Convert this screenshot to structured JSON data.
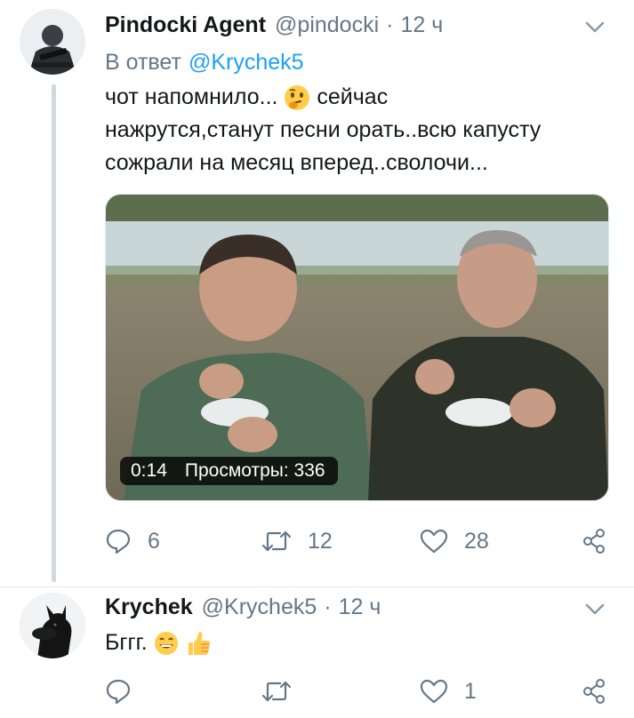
{
  "tweet1": {
    "author_name": "Pindocki Agent",
    "author_handle": "@pindocki",
    "separator": "·",
    "time": "12 ч",
    "reply_prefix": "В ответ",
    "reply_mention": "@Krychek5",
    "text_line1_a": "чот напомнило...",
    "text_line1_b": "сейчас",
    "text_line2": "нажрутся,станут песни орать..всю капусту",
    "text_line3": "сожрали на месяц вперед..сволочи...",
    "emoji": "thinking-face-emoji",
    "video": {
      "duration": "0:14",
      "views": "Просмотры: 336"
    },
    "actions": {
      "replies": "6",
      "retweets": "12",
      "likes": "28"
    }
  },
  "tweet2": {
    "author_name": "Krychek",
    "author_handle": "@Krychek5",
    "separator": "·",
    "time": "12 ч",
    "text": "Бггг.",
    "emojis": [
      "grinning-face-emoji",
      "thumbs-up-emoji"
    ],
    "actions": {
      "replies": "",
      "retweets": "",
      "likes": "1"
    }
  },
  "colors": {
    "link": "#1da1f2",
    "secondary": "#657786",
    "text": "#14171a",
    "thread_line": "#cfd9de"
  }
}
